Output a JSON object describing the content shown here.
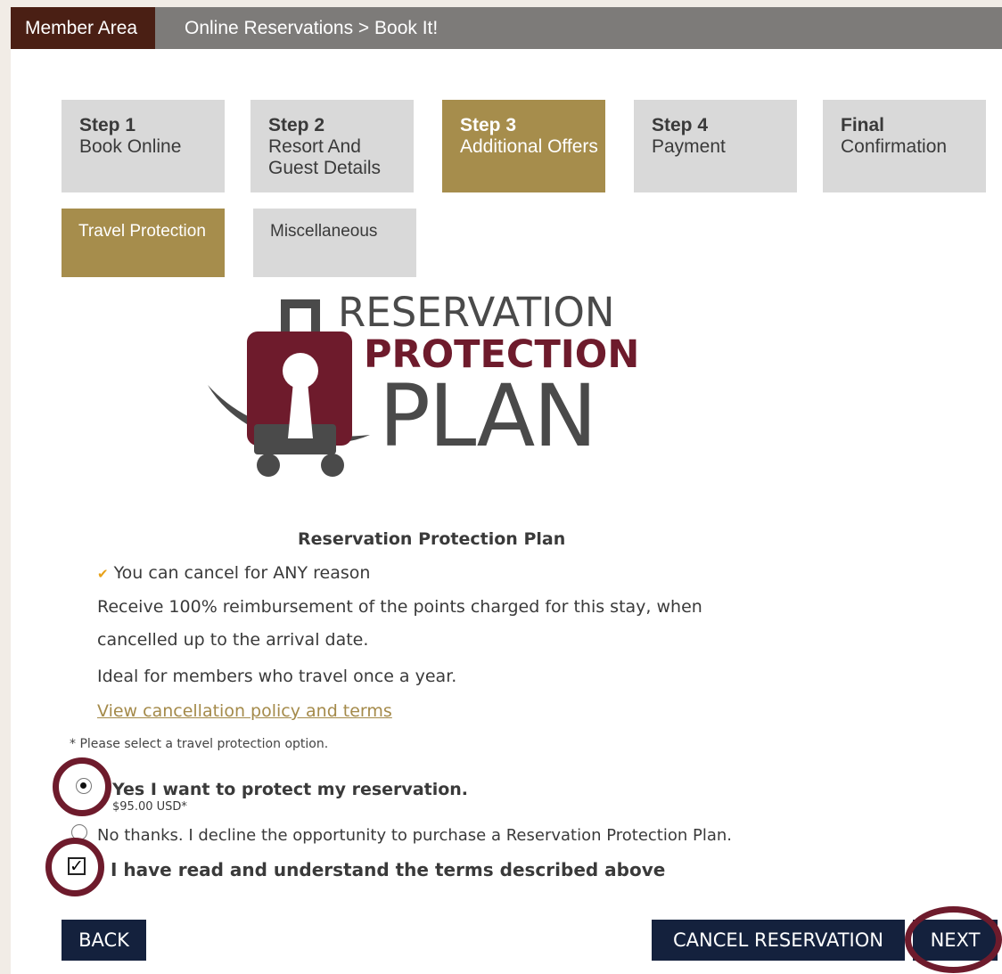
{
  "header": {
    "member_area": "Member Area",
    "breadcrumb": "Online Reservations > Book It!"
  },
  "steps": [
    {
      "num": "Step 1",
      "label": "Book Online",
      "active": false
    },
    {
      "num": "Step 2",
      "label": "Resort And\nGuest Details",
      "active": false
    },
    {
      "num": "Step 3",
      "label": "Additional Offers",
      "active": true
    },
    {
      "num": "Step 4",
      "label": "Payment",
      "active": false
    },
    {
      "num": "Final",
      "label": "Confirmation",
      "active": false
    }
  ],
  "subtabs": [
    {
      "label": "Travel Protection",
      "active": true
    },
    {
      "label": "Miscellaneous",
      "active": false
    }
  ],
  "logo": {
    "line1": "RESERVATION",
    "line2": "PROTECTION",
    "line3": "PLAN",
    "colors": {
      "maroon": "#6e1b2c",
      "gray": "#4a4a4a"
    }
  },
  "plan": {
    "title": "Reservation Protection Plan",
    "cancel_any": "You can cancel for ANY reason",
    "reimburse_1": "Receive 100% reimbursement of the points charged for this stay, when",
    "reimburse_2": "cancelled up to the arrival date.",
    "ideal": "Ideal for members who travel once a year.",
    "policy_link": "View cancellation policy and terms"
  },
  "form": {
    "note": "* Please select a travel protection option.",
    "yes_label": "Yes  I want to protect my reservation.",
    "yes_price": "$95.00 USD*",
    "yes_selected": true,
    "no_label": "No thanks. I decline the opportunity to purchase a Reservation Protection Plan.",
    "terms_label": "I have read and understand the terms described above",
    "terms_checked": true
  },
  "buttons": {
    "back": "BACK",
    "cancel": "CANCEL RESERVATION",
    "next": "NEXT"
  },
  "colors": {
    "gold": "#a68d4c",
    "navy": "#14213d",
    "highlight_circle": "#6e1b2c"
  }
}
